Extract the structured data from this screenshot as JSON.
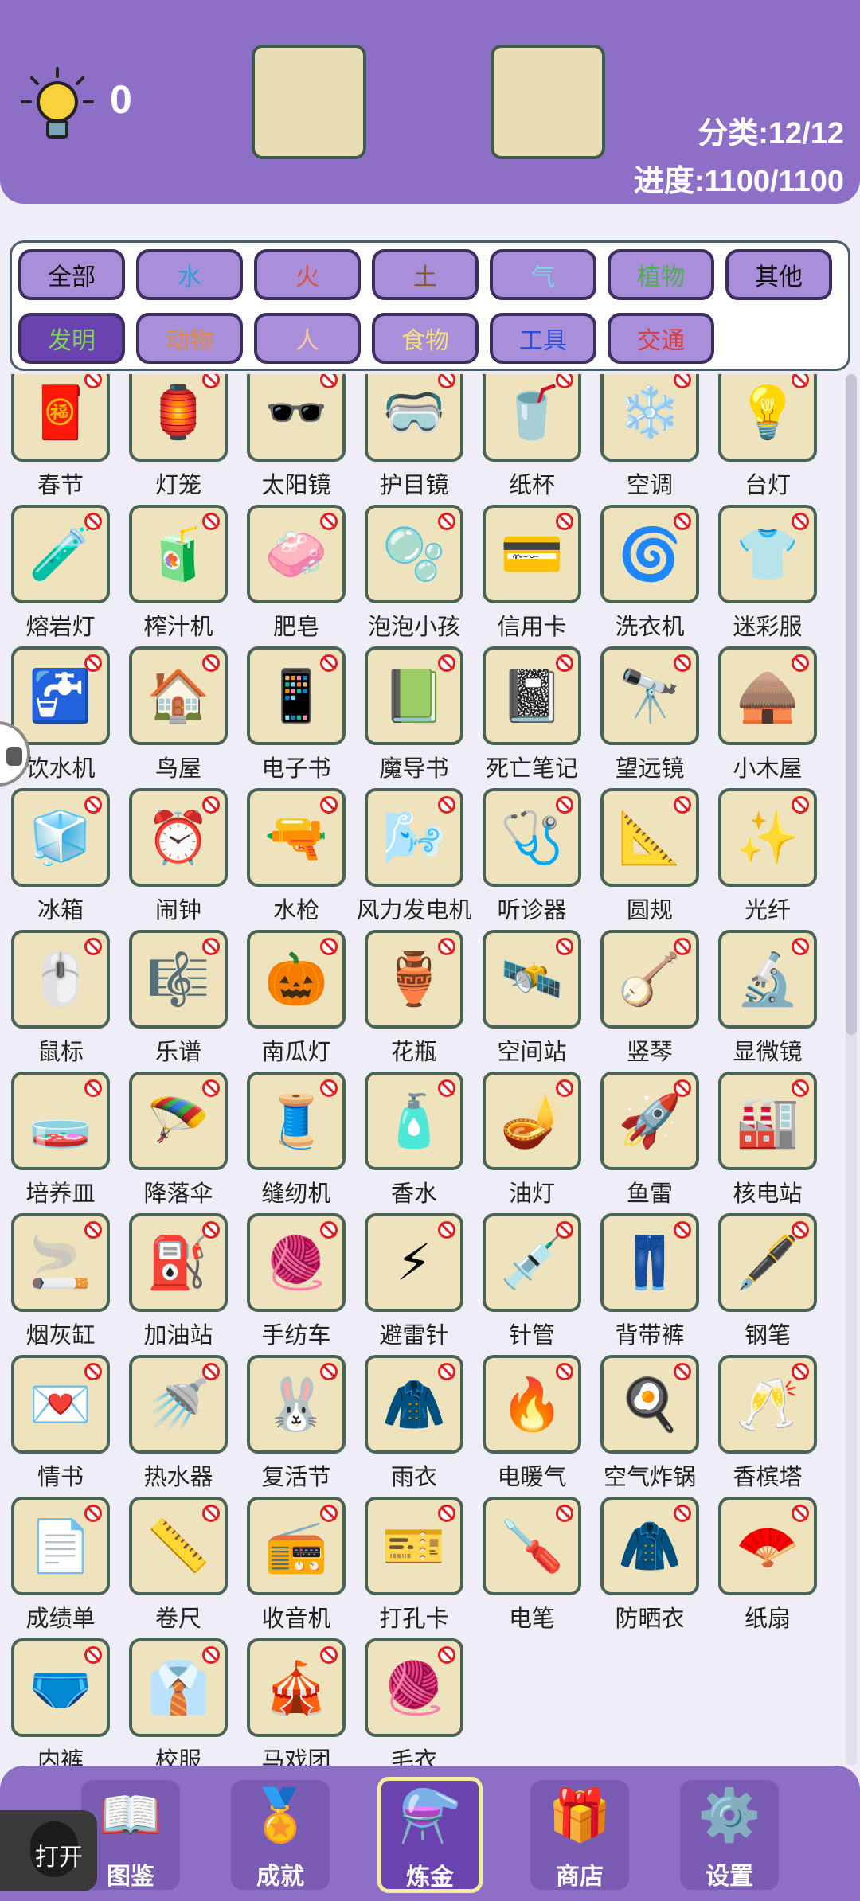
{
  "header": {
    "hint_count": "0",
    "category_stat": "分类:12/12",
    "progress_stat": "进度:1100/1100"
  },
  "categories": [
    {
      "label": "全部",
      "color": "#111111",
      "selected": false
    },
    {
      "label": "水",
      "color": "#2a9fd6",
      "selected": false
    },
    {
      "label": "火",
      "color": "#e0503a",
      "selected": false
    },
    {
      "label": "土",
      "color": "#8a5a2b",
      "selected": false
    },
    {
      "label": "气",
      "color": "#7fd3e6",
      "selected": false
    },
    {
      "label": "植物",
      "color": "#4caf50",
      "selected": false
    },
    {
      "label": "其他",
      "color": "#111111",
      "selected": false
    },
    {
      "label": "发明",
      "color": "#7cd35a",
      "selected": true
    },
    {
      "label": "动物",
      "color": "#e08a3a",
      "selected": false
    },
    {
      "label": "人",
      "color": "#f7c8a0",
      "selected": false
    },
    {
      "label": "食物",
      "color": "#f5e27a",
      "selected": false
    },
    {
      "label": "工具",
      "color": "#2d4fd6",
      "selected": false
    },
    {
      "label": "交通",
      "color": "#e03a3a",
      "selected": false
    }
  ],
  "items": [
    {
      "label": "春节",
      "icon": "🧧"
    },
    {
      "label": "灯笼",
      "icon": "🏮"
    },
    {
      "label": "太阳镜",
      "icon": "🕶️"
    },
    {
      "label": "护目镜",
      "icon": "🥽"
    },
    {
      "label": "纸杯",
      "icon": "🥤"
    },
    {
      "label": "空调",
      "icon": "❄️"
    },
    {
      "label": "台灯",
      "icon": "💡"
    },
    {
      "label": "熔岩灯",
      "icon": "🧪"
    },
    {
      "label": "榨汁机",
      "icon": "🧃"
    },
    {
      "label": "肥皂",
      "icon": "🧼"
    },
    {
      "label": "泡泡小孩",
      "icon": "🫧"
    },
    {
      "label": "信用卡",
      "icon": "💳"
    },
    {
      "label": "洗衣机",
      "icon": "🌀"
    },
    {
      "label": "迷彩服",
      "icon": "👕"
    },
    {
      "label": "饮水机",
      "icon": "🚰"
    },
    {
      "label": "鸟屋",
      "icon": "🏠"
    },
    {
      "label": "电子书",
      "icon": "📱"
    },
    {
      "label": "魔导书",
      "icon": "📗"
    },
    {
      "label": "死亡笔记",
      "icon": "📓"
    },
    {
      "label": "望远镜",
      "icon": "🔭"
    },
    {
      "label": "小木屋",
      "icon": "🛖"
    },
    {
      "label": "冰箱",
      "icon": "🧊"
    },
    {
      "label": "闹钟",
      "icon": "⏰"
    },
    {
      "label": "水枪",
      "icon": "🔫"
    },
    {
      "label": "风力发电机",
      "icon": "🌬️"
    },
    {
      "label": "听诊器",
      "icon": "🩺"
    },
    {
      "label": "圆规",
      "icon": "📐"
    },
    {
      "label": "光纤",
      "icon": "✨"
    },
    {
      "label": "鼠标",
      "icon": "🖱️"
    },
    {
      "label": "乐谱",
      "icon": "🎼"
    },
    {
      "label": "南瓜灯",
      "icon": "🎃"
    },
    {
      "label": "花瓶",
      "icon": "🏺"
    },
    {
      "label": "空间站",
      "icon": "🛰️"
    },
    {
      "label": "竖琴",
      "icon": "🪕"
    },
    {
      "label": "显微镜",
      "icon": "🔬"
    },
    {
      "label": "培养皿",
      "icon": "🧫"
    },
    {
      "label": "降落伞",
      "icon": "🪂"
    },
    {
      "label": "缝纫机",
      "icon": "🧵"
    },
    {
      "label": "香水",
      "icon": "🧴"
    },
    {
      "label": "油灯",
      "icon": "🪔"
    },
    {
      "label": "鱼雷",
      "icon": "🚀"
    },
    {
      "label": "核电站",
      "icon": "🏭"
    },
    {
      "label": "烟灰缸",
      "icon": "🚬"
    },
    {
      "label": "加油站",
      "icon": "⛽"
    },
    {
      "label": "手纺车",
      "icon": "🧶"
    },
    {
      "label": "避雷针",
      "icon": "⚡"
    },
    {
      "label": "针管",
      "icon": "💉"
    },
    {
      "label": "背带裤",
      "icon": "👖"
    },
    {
      "label": "钢笔",
      "icon": "🖋️"
    },
    {
      "label": "情书",
      "icon": "💌"
    },
    {
      "label": "热水器",
      "icon": "🚿"
    },
    {
      "label": "复活节",
      "icon": "🐰"
    },
    {
      "label": "雨衣",
      "icon": "🧥"
    },
    {
      "label": "电暖气",
      "icon": "🔥"
    },
    {
      "label": "空气炸锅",
      "icon": "🍳"
    },
    {
      "label": "香槟塔",
      "icon": "🥂"
    },
    {
      "label": "成绩单",
      "icon": "📄"
    },
    {
      "label": "卷尺",
      "icon": "📏"
    },
    {
      "label": "收音机",
      "icon": "📻"
    },
    {
      "label": "打孔卡",
      "icon": "🎫"
    },
    {
      "label": "电笔",
      "icon": "🪛"
    },
    {
      "label": "防晒衣",
      "icon": "🧥"
    },
    {
      "label": "纸扇",
      "icon": "🪭"
    },
    {
      "label": "内裤",
      "icon": "🩲"
    },
    {
      "label": "校服",
      "icon": "👔"
    },
    {
      "label": "马戏团",
      "icon": "🎪"
    },
    {
      "label": "毛衣",
      "icon": "🧶"
    }
  ],
  "nav": [
    {
      "label": "图鉴",
      "icon": "📖",
      "active": false
    },
    {
      "label": "成就",
      "icon": "🏅",
      "active": false
    },
    {
      "label": "炼金",
      "icon": "⚗️",
      "active": true
    },
    {
      "label": "商店",
      "icon": "🎁",
      "active": false
    },
    {
      "label": "设置",
      "icon": "⚙️",
      "active": false
    }
  ],
  "open_button": "打开"
}
